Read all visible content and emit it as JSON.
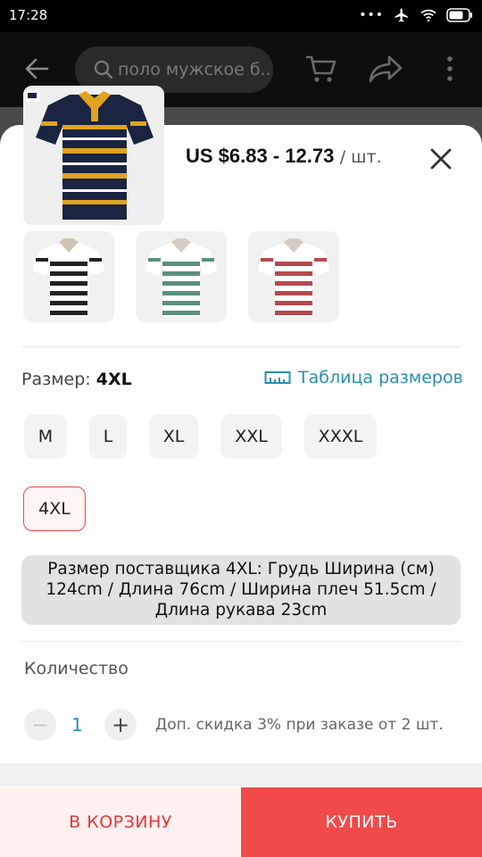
{
  "status_bar": {
    "time": "17:28"
  },
  "app_bar": {
    "search_text": "поло мужское б..."
  },
  "product": {
    "price": "US $6.83 - 12.73",
    "price_unit": "/ шт.",
    "variants": [
      {
        "name": "black-white-stripes",
        "color": "#222222",
        "stripe": "#ffffff",
        "collar": "#cfc4b4"
      },
      {
        "name": "green-white-stripes",
        "color": "#5c8f7e",
        "stripe": "#ffffff",
        "collar": "#d8ccc0"
      },
      {
        "name": "red-white-stripes",
        "color": "#b44a4e",
        "stripe": "#ffffff",
        "collar": "#d8cac0"
      }
    ]
  },
  "size": {
    "label": "Размер:",
    "selected": "4XL",
    "table_link": "Таблица размеров",
    "options": [
      "M",
      "L",
      "XL",
      "XXL",
      "XXXL",
      "4XL"
    ],
    "supplier_info": "Размер поставщика 4XL: Грудь Ширина (см) 124cm / Длина 76cm / Ширина плеч 51.5cm / Длина рукава 23cm"
  },
  "quantity": {
    "label": "Количество",
    "minus": "−",
    "value": "1",
    "plus": "+",
    "discount_note": "Доп. скидка 3% при заказе от 2 шт."
  },
  "actions": {
    "add_to_cart": "В КОРЗИНУ",
    "buy": "КУПИТЬ"
  },
  "colors": {
    "accent_red": "#f14a4a",
    "link_blue": "#2a8fb2",
    "selected_border": "#e8484a"
  }
}
